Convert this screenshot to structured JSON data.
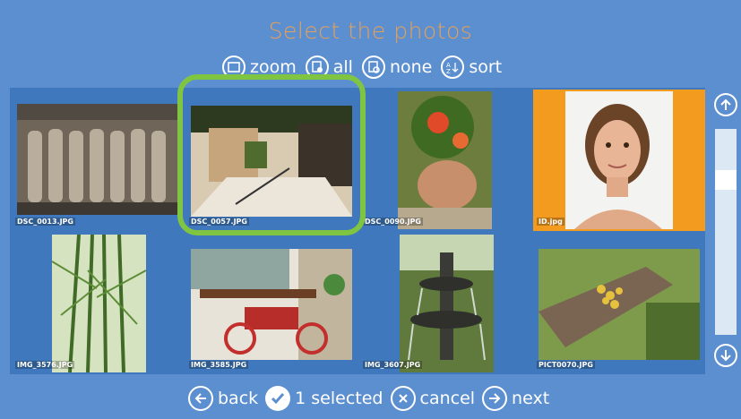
{
  "title": "Select the photos",
  "toolbar": {
    "zoom": "zoom",
    "all": "all",
    "none": "none",
    "sort": "sort"
  },
  "photos": [
    {
      "name": "DSC_0013.JPG",
      "icon": "photo-thumbnail"
    },
    {
      "name": "DSC_0057.JPG",
      "icon": "photo-thumbnail"
    },
    {
      "name": "DSC_0090.JPG",
      "icon": "photo-thumbnail"
    },
    {
      "name": "ID.jpg",
      "icon": "photo-thumbnail"
    },
    {
      "name": "IMG_3576.JPG",
      "icon": "photo-thumbnail"
    },
    {
      "name": "IMG_3585.JPG",
      "icon": "photo-thumbnail"
    },
    {
      "name": "IMG_3607.JPG",
      "icon": "photo-thumbnail"
    },
    {
      "name": "PICT0070.JPG",
      "icon": "photo-thumbnail"
    }
  ],
  "bottom": {
    "back": "back",
    "selected": "1 selected",
    "cancel": "cancel",
    "next": "next"
  },
  "colors": {
    "background": "#5c8fd0",
    "title": "#e8a055",
    "selected_tile": "#f39b1e",
    "highlight": "#7fc542"
  }
}
